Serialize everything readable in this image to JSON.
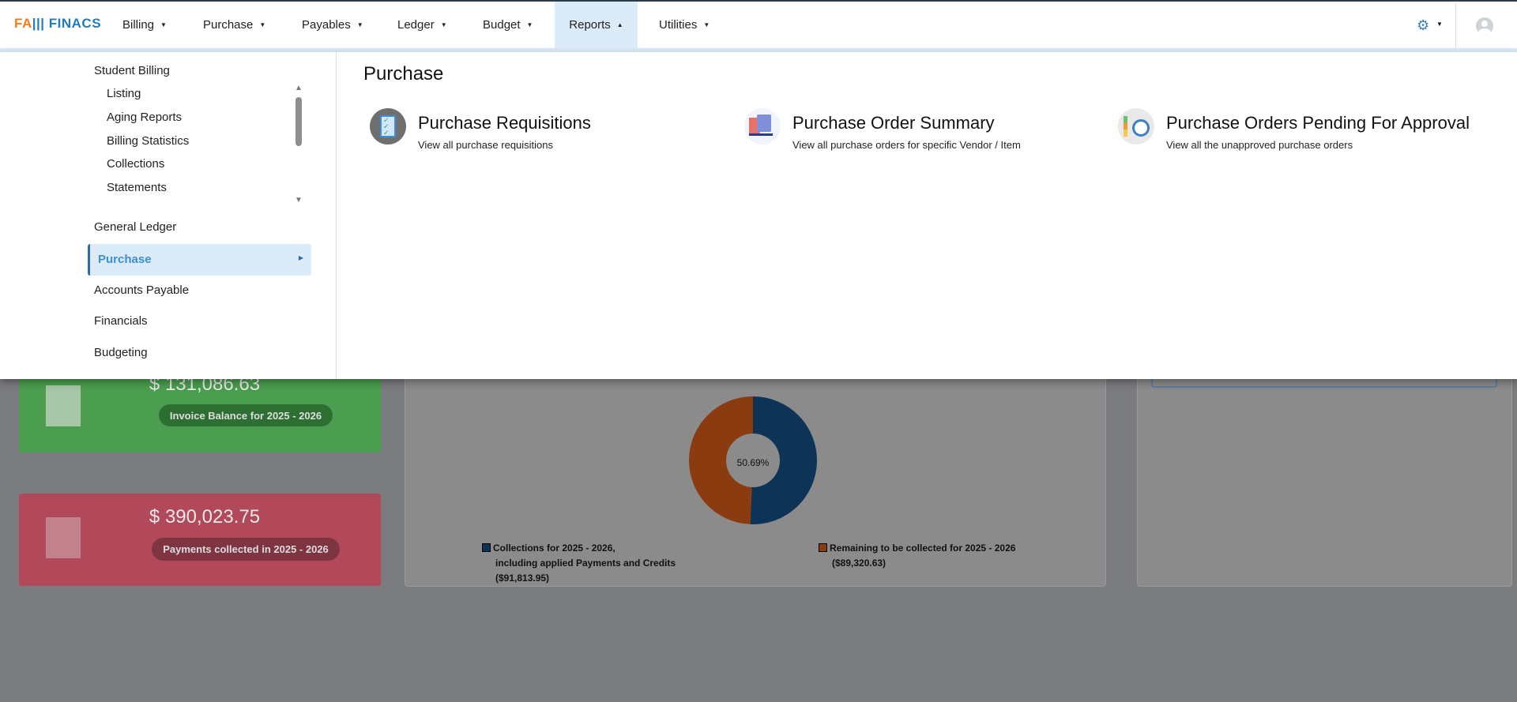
{
  "app": {
    "logo": "FINACS"
  },
  "nav": {
    "items": [
      {
        "label": "Billing"
      },
      {
        "label": "Purchase"
      },
      {
        "label": "Payables"
      },
      {
        "label": "Ledger"
      },
      {
        "label": "Budget"
      },
      {
        "label": "Reports",
        "active": true
      },
      {
        "label": "Utilities"
      }
    ],
    "settings_icon": "gear-icon",
    "avatar_icon": "user-avatar-icon"
  },
  "reports_menu": {
    "sidebar": {
      "student_billing": "Student Billing",
      "sub_items": [
        "Listing",
        "Aging Reports",
        "Billing Statistics",
        "Collections",
        "Statements"
      ],
      "items": [
        "General Ledger",
        "Purchase",
        "Accounts Payable",
        "Financials",
        "Budgeting"
      ],
      "active": "Purchase"
    },
    "section_title": "Purchase",
    "cards": [
      {
        "title": "Purchase Requisitions",
        "desc": "View all purchase requisitions",
        "icon": "checklist-icon"
      },
      {
        "title": "Purchase Order Summary",
        "desc": "View all purchase orders for specific Vendor / Item",
        "icon": "shopping-bag-icon"
      },
      {
        "title": "Purchase Orders Pending For Approval",
        "desc": "View all the unapproved purchase orders",
        "icon": "clock-list-icon"
      }
    ]
  },
  "dashboard": {
    "invoice_balance": {
      "amount": "$ 131,086.63",
      "label": "Invoice Balance for 2025 - 2026"
    },
    "payments": {
      "amount": "$ 390,023.75",
      "label": "Payments collected in 2025 - 2026"
    }
  },
  "chart_data": {
    "type": "pie",
    "donut": true,
    "center_label": "50.69%",
    "series": [
      {
        "name": "Collections for 2025 - 2026, including applied Payments and Credits ($91,813.95)",
        "value": 91813.95,
        "color": "#0d3357"
      },
      {
        "name": "Remaining to be collected for 2025 - 2026 ($89,320.63)",
        "value": 89320.63,
        "color": "#8a3c10"
      }
    ],
    "legend": {
      "placement": "bottom",
      "lines1": [
        "Collections for 2025 - 2026,",
        "including applied Payments and Credits",
        "($91,813.95)"
      ],
      "lines2": [
        "Remaining to be collected for 2025 - 2026",
        "($89,320.63)"
      ]
    }
  }
}
